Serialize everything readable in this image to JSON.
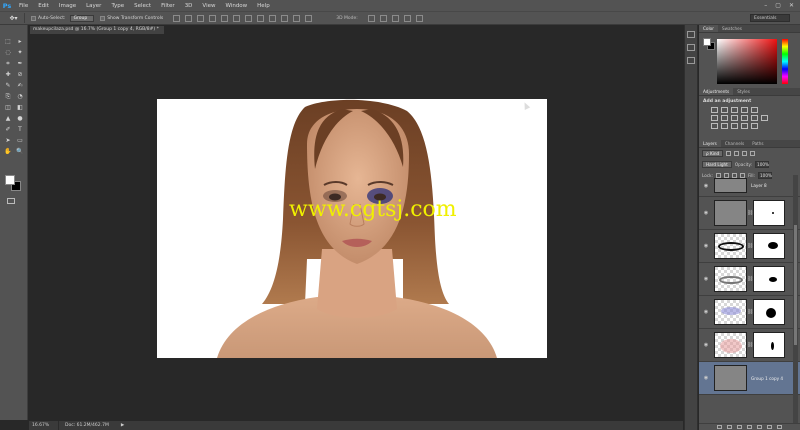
{
  "app": {
    "logo": "Ps"
  },
  "menu": [
    "File",
    "Edit",
    "Image",
    "Layer",
    "Type",
    "Select",
    "Filter",
    "3D",
    "View",
    "Window",
    "Help"
  ],
  "window_controls": [
    "–",
    "▢",
    "✕"
  ],
  "options_bar": {
    "tool_glyph": "✥▾",
    "auto_select_label": "Auto-Select:",
    "auto_select_value": "Group",
    "transform_label": "Show Transform Controls",
    "mode3d_label": "3D Mode:",
    "workspace": "Essentials"
  },
  "tools": [
    "⬚",
    "▸",
    "◌",
    "✦",
    "⌗",
    "✒",
    "✚",
    "⊘",
    "✎",
    "✍",
    "⎘",
    "◔",
    "◫",
    "◧",
    "▲",
    "●",
    "✐",
    "T",
    "➤",
    "▭",
    "✋",
    "🔍"
  ],
  "document": {
    "tab_title": "makeupcilaza.psd @ 16.7% (Group 1 copy 4, RGB/8#) *",
    "watermark": "www.cgtsj.com"
  },
  "status": {
    "zoom": "16.67%",
    "doc_size": "Doc: 61.2M/462.7M",
    "arrow": "▶"
  },
  "panels": {
    "color_tabs": [
      "Color",
      "Swatches"
    ],
    "adjust_tabs": [
      "Adjustments",
      "Styles"
    ],
    "adjust_title": "Add an adjustment",
    "layer_tabs": [
      "Layers",
      "Channels",
      "Paths"
    ],
    "kind_label": "ρ Kind",
    "blend_mode": "Hard Light",
    "opacity_label": "Opacity:",
    "opacity_value": "100%",
    "lock_label": "Lock:",
    "fill_label": "Fill:",
    "fill_value": "100%"
  },
  "layers": [
    {
      "name": "Layer 8",
      "eye": "◉"
    },
    {
      "name": "",
      "eye": "◉"
    },
    {
      "name": "",
      "eye": "◉"
    },
    {
      "name": "",
      "eye": "◉"
    },
    {
      "name": "",
      "eye": "◉"
    },
    {
      "name": "",
      "eye": "◉"
    },
    {
      "name": "Group 1 copy 4",
      "eye": "◉"
    }
  ],
  "colors": {
    "accent": "#31a8ff",
    "selected_layer": "#637592",
    "watermark": "#f0f000"
  }
}
